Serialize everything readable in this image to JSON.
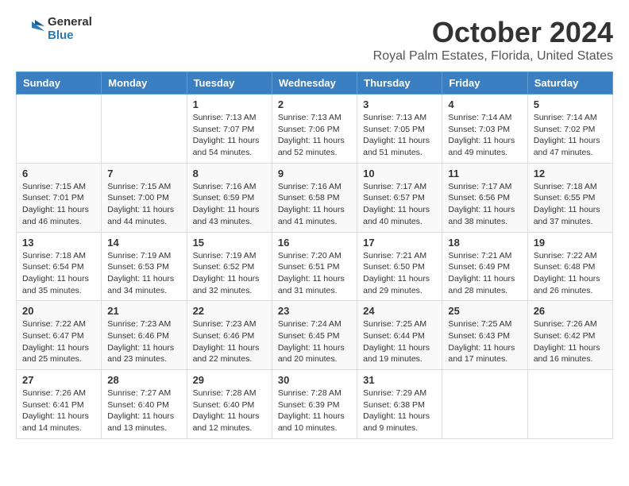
{
  "logo": {
    "general": "General",
    "blue": "Blue"
  },
  "title": "October 2024",
  "location": "Royal Palm Estates, Florida, United States",
  "weekdays": [
    "Sunday",
    "Monday",
    "Tuesday",
    "Wednesday",
    "Thursday",
    "Friday",
    "Saturday"
  ],
  "weeks": [
    [
      {
        "day": "",
        "sunrise": "",
        "sunset": "",
        "daylight": ""
      },
      {
        "day": "",
        "sunrise": "",
        "sunset": "",
        "daylight": ""
      },
      {
        "day": "1",
        "sunrise": "Sunrise: 7:13 AM",
        "sunset": "Sunset: 7:07 PM",
        "daylight": "Daylight: 11 hours and 54 minutes."
      },
      {
        "day": "2",
        "sunrise": "Sunrise: 7:13 AM",
        "sunset": "Sunset: 7:06 PM",
        "daylight": "Daylight: 11 hours and 52 minutes."
      },
      {
        "day": "3",
        "sunrise": "Sunrise: 7:13 AM",
        "sunset": "Sunset: 7:05 PM",
        "daylight": "Daylight: 11 hours and 51 minutes."
      },
      {
        "day": "4",
        "sunrise": "Sunrise: 7:14 AM",
        "sunset": "Sunset: 7:03 PM",
        "daylight": "Daylight: 11 hours and 49 minutes."
      },
      {
        "day": "5",
        "sunrise": "Sunrise: 7:14 AM",
        "sunset": "Sunset: 7:02 PM",
        "daylight": "Daylight: 11 hours and 47 minutes."
      }
    ],
    [
      {
        "day": "6",
        "sunrise": "Sunrise: 7:15 AM",
        "sunset": "Sunset: 7:01 PM",
        "daylight": "Daylight: 11 hours and 46 minutes."
      },
      {
        "day": "7",
        "sunrise": "Sunrise: 7:15 AM",
        "sunset": "Sunset: 7:00 PM",
        "daylight": "Daylight: 11 hours and 44 minutes."
      },
      {
        "day": "8",
        "sunrise": "Sunrise: 7:16 AM",
        "sunset": "Sunset: 6:59 PM",
        "daylight": "Daylight: 11 hours and 43 minutes."
      },
      {
        "day": "9",
        "sunrise": "Sunrise: 7:16 AM",
        "sunset": "Sunset: 6:58 PM",
        "daylight": "Daylight: 11 hours and 41 minutes."
      },
      {
        "day": "10",
        "sunrise": "Sunrise: 7:17 AM",
        "sunset": "Sunset: 6:57 PM",
        "daylight": "Daylight: 11 hours and 40 minutes."
      },
      {
        "day": "11",
        "sunrise": "Sunrise: 7:17 AM",
        "sunset": "Sunset: 6:56 PM",
        "daylight": "Daylight: 11 hours and 38 minutes."
      },
      {
        "day": "12",
        "sunrise": "Sunrise: 7:18 AM",
        "sunset": "Sunset: 6:55 PM",
        "daylight": "Daylight: 11 hours and 37 minutes."
      }
    ],
    [
      {
        "day": "13",
        "sunrise": "Sunrise: 7:18 AM",
        "sunset": "Sunset: 6:54 PM",
        "daylight": "Daylight: 11 hours and 35 minutes."
      },
      {
        "day": "14",
        "sunrise": "Sunrise: 7:19 AM",
        "sunset": "Sunset: 6:53 PM",
        "daylight": "Daylight: 11 hours and 34 minutes."
      },
      {
        "day": "15",
        "sunrise": "Sunrise: 7:19 AM",
        "sunset": "Sunset: 6:52 PM",
        "daylight": "Daylight: 11 hours and 32 minutes."
      },
      {
        "day": "16",
        "sunrise": "Sunrise: 7:20 AM",
        "sunset": "Sunset: 6:51 PM",
        "daylight": "Daylight: 11 hours and 31 minutes."
      },
      {
        "day": "17",
        "sunrise": "Sunrise: 7:21 AM",
        "sunset": "Sunset: 6:50 PM",
        "daylight": "Daylight: 11 hours and 29 minutes."
      },
      {
        "day": "18",
        "sunrise": "Sunrise: 7:21 AM",
        "sunset": "Sunset: 6:49 PM",
        "daylight": "Daylight: 11 hours and 28 minutes."
      },
      {
        "day": "19",
        "sunrise": "Sunrise: 7:22 AM",
        "sunset": "Sunset: 6:48 PM",
        "daylight": "Daylight: 11 hours and 26 minutes."
      }
    ],
    [
      {
        "day": "20",
        "sunrise": "Sunrise: 7:22 AM",
        "sunset": "Sunset: 6:47 PM",
        "daylight": "Daylight: 11 hours and 25 minutes."
      },
      {
        "day": "21",
        "sunrise": "Sunrise: 7:23 AM",
        "sunset": "Sunset: 6:46 PM",
        "daylight": "Daylight: 11 hours and 23 minutes."
      },
      {
        "day": "22",
        "sunrise": "Sunrise: 7:23 AM",
        "sunset": "Sunset: 6:46 PM",
        "daylight": "Daylight: 11 hours and 22 minutes."
      },
      {
        "day": "23",
        "sunrise": "Sunrise: 7:24 AM",
        "sunset": "Sunset: 6:45 PM",
        "daylight": "Daylight: 11 hours and 20 minutes."
      },
      {
        "day": "24",
        "sunrise": "Sunrise: 7:25 AM",
        "sunset": "Sunset: 6:44 PM",
        "daylight": "Daylight: 11 hours and 19 minutes."
      },
      {
        "day": "25",
        "sunrise": "Sunrise: 7:25 AM",
        "sunset": "Sunset: 6:43 PM",
        "daylight": "Daylight: 11 hours and 17 minutes."
      },
      {
        "day": "26",
        "sunrise": "Sunrise: 7:26 AM",
        "sunset": "Sunset: 6:42 PM",
        "daylight": "Daylight: 11 hours and 16 minutes."
      }
    ],
    [
      {
        "day": "27",
        "sunrise": "Sunrise: 7:26 AM",
        "sunset": "Sunset: 6:41 PM",
        "daylight": "Daylight: 11 hours and 14 minutes."
      },
      {
        "day": "28",
        "sunrise": "Sunrise: 7:27 AM",
        "sunset": "Sunset: 6:40 PM",
        "daylight": "Daylight: 11 hours and 13 minutes."
      },
      {
        "day": "29",
        "sunrise": "Sunrise: 7:28 AM",
        "sunset": "Sunset: 6:40 PM",
        "daylight": "Daylight: 11 hours and 12 minutes."
      },
      {
        "day": "30",
        "sunrise": "Sunrise: 7:28 AM",
        "sunset": "Sunset: 6:39 PM",
        "daylight": "Daylight: 11 hours and 10 minutes."
      },
      {
        "day": "31",
        "sunrise": "Sunrise: 7:29 AM",
        "sunset": "Sunset: 6:38 PM",
        "daylight": "Daylight: 11 hours and 9 minutes."
      },
      {
        "day": "",
        "sunrise": "",
        "sunset": "",
        "daylight": ""
      },
      {
        "day": "",
        "sunrise": "",
        "sunset": "",
        "daylight": ""
      }
    ]
  ]
}
